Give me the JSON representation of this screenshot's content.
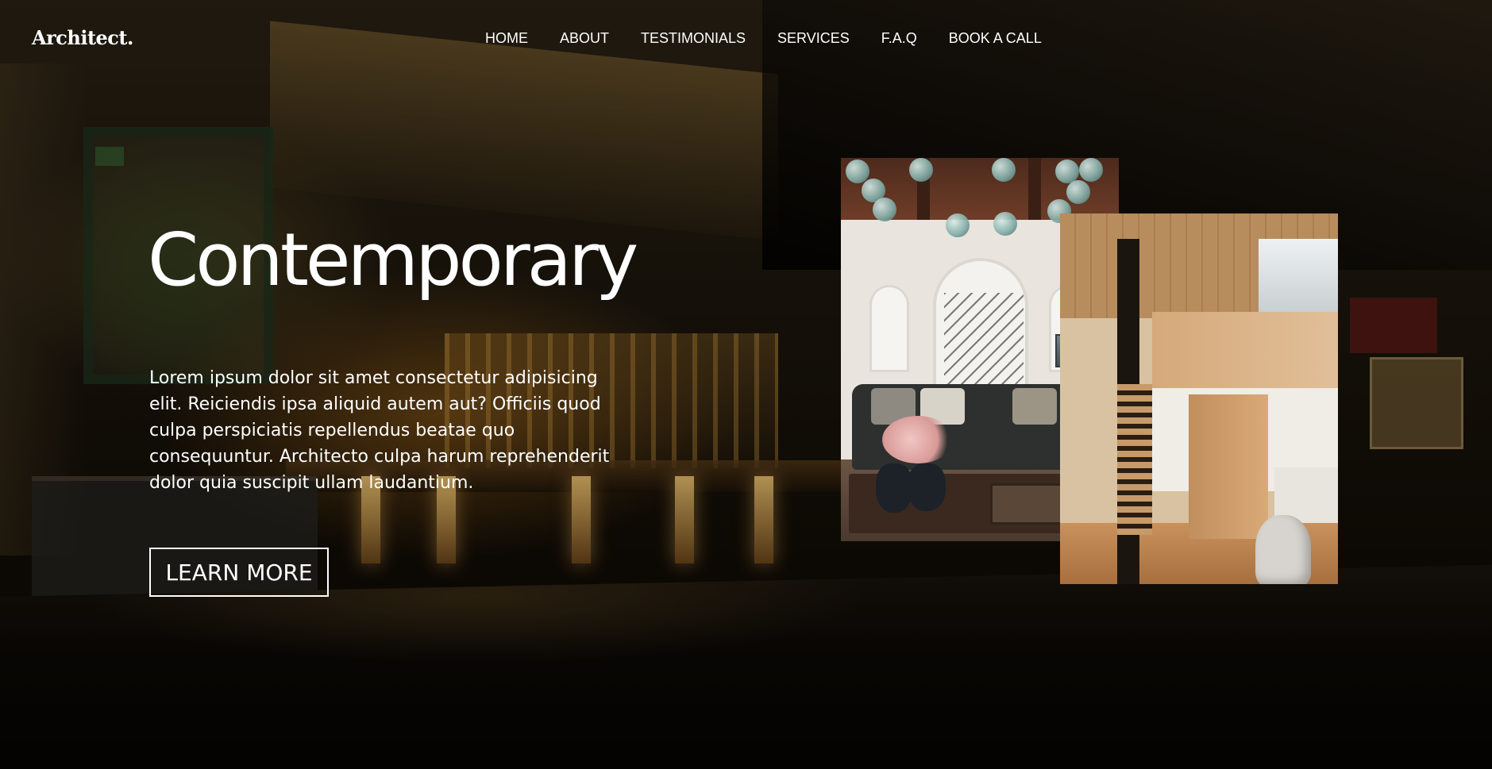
{
  "header": {
    "logo": "Architect.",
    "nav": [
      "HOME",
      "ABOUT",
      "TESTIMONIALS",
      "SERVICES",
      "F.A.Q",
      "BOOK A CALL"
    ]
  },
  "hero": {
    "title": "Contemporary",
    "body": "Lorem ipsum dolor sit amet consectetur adipisicing elit. Reiciendis ipsa aliquid autem aut? Officiis quod culpa perspiciatis repellendus beatae quo consequuntur. Architecto culpa harum reprehenderit dolor quia suscipit ullam laudantium.",
    "cta_label": "LEARN MORE"
  },
  "colors": {
    "text": "#ffffff",
    "background": "#000000"
  }
}
